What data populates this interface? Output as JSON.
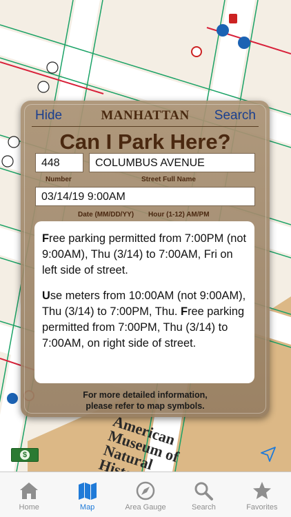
{
  "map": {
    "museum_label": "American\nMuseum of\nNatural\nHisto"
  },
  "panel": {
    "hide_label": "Hide",
    "borough": "MANHATTAN",
    "search_label": "Search",
    "title": "Can I Park Here?",
    "number_value": "448",
    "number_label": "Number",
    "street_value": "COLUMBUS AVENUE",
    "street_label": "Street Full Name",
    "datetime_value": "03/14/19 9:00AM",
    "date_label": "Date (MM/DD/YY)",
    "hour_label": "Hour (1-12) AM/PM",
    "info": {
      "p1_cap": "F",
      "p1_text": "ree parking permitted from 7:00PM (not 9:00AM), Thu (3/14) to 7:00AM, Fri on left side of street.",
      "p2_cap1": "U",
      "p2_text1": "se meters from 10:00AM (not 9:00AM), Thu (3/14) to 7:00PM, Thu. ",
      "p2_cap2": "F",
      "p2_text2": "ree parking permitted from 7:00PM, Thu (3/14) to 7:00AM, on right side of street."
    },
    "footer_line1": "For more detailed information,",
    "footer_line2": "please refer to map symbols."
  },
  "tabs": [
    {
      "label": "Home",
      "icon": "home-icon",
      "active": false
    },
    {
      "label": "Map",
      "icon": "map-icon",
      "active": true
    },
    {
      "label": "Area Gauge",
      "icon": "compass-icon",
      "active": false
    },
    {
      "label": "Search",
      "icon": "search-icon",
      "active": false
    },
    {
      "label": "Favorites",
      "icon": "star-icon",
      "active": false
    }
  ],
  "colors": {
    "accent": "#1f7ad8",
    "panel_text": "#4a2810",
    "link": "#1a3f8f",
    "park_green": "#2b7a32"
  }
}
